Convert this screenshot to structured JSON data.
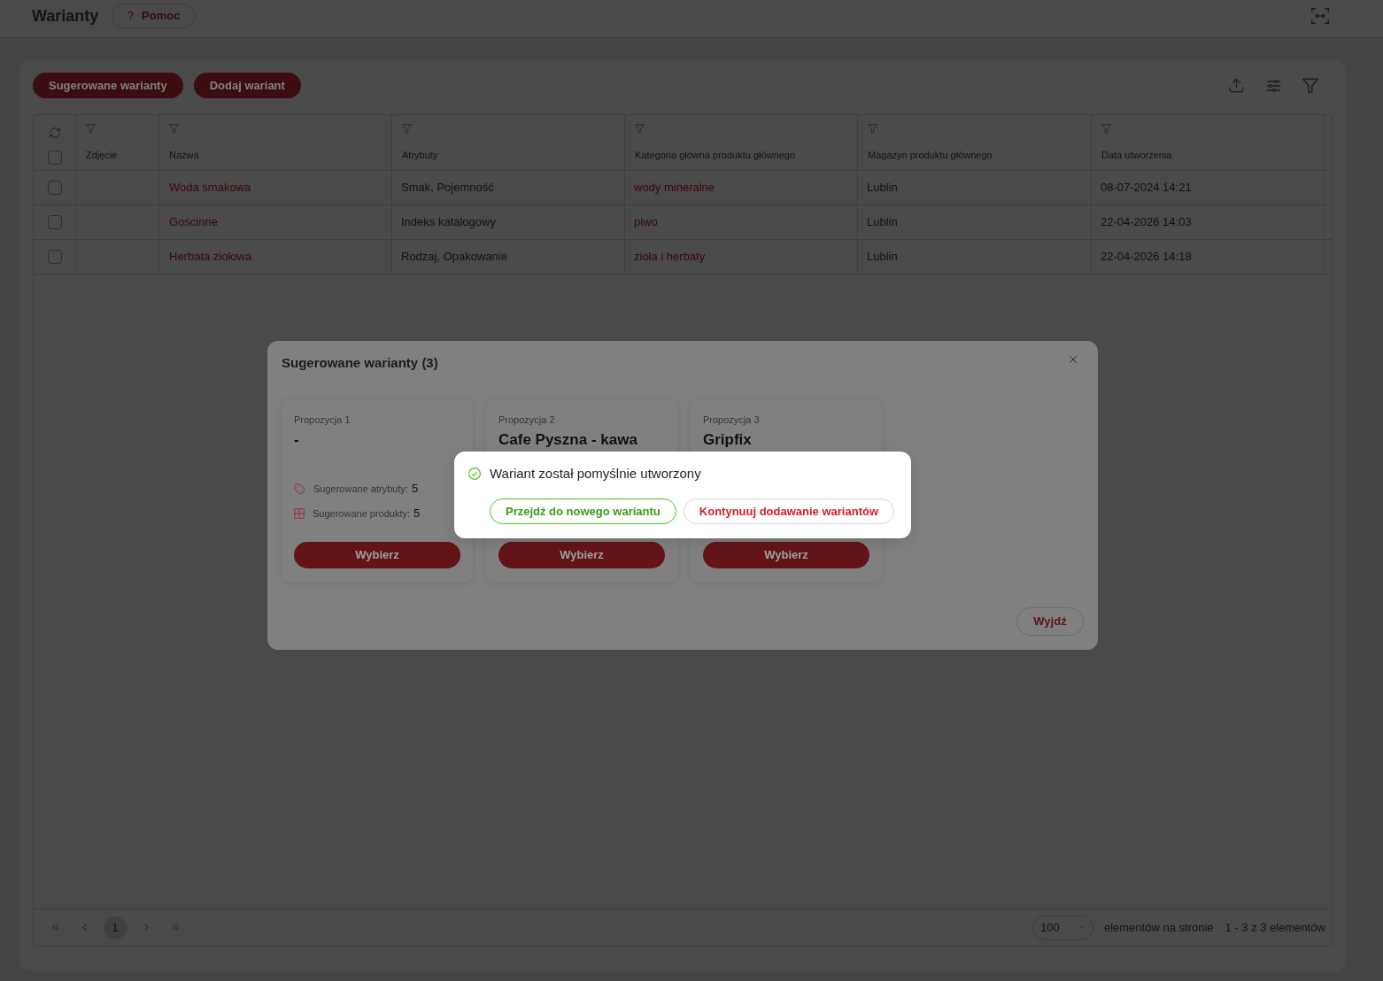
{
  "header": {
    "title": "Warianty",
    "help_button": {
      "icon": "?",
      "label": "Pomoc"
    }
  },
  "toolbar": {
    "buttons": [
      "Sugerowane warianty",
      "Dodaj wariant"
    ]
  },
  "table": {
    "select_all_checked": false,
    "columns": [
      {
        "label": "Zdjęcie",
        "filter": true
      },
      {
        "label": "Nazwa",
        "filter": true
      },
      {
        "label": "Atrybuty",
        "filter": true
      },
      {
        "label": "Kategoria główna produktu głównego",
        "filter": true
      },
      {
        "label": "Magazyn produktu głównego",
        "filter": true
      },
      {
        "label": "Data utworzenia",
        "filter": true
      }
    ],
    "rows": [
      {
        "checked": false,
        "name": "Woda smakowa",
        "attributes": "Smak, Pojemność",
        "category": "wody mineralne",
        "warehouse": "Lublin",
        "created": "08-07-2024 14:21"
      },
      {
        "checked": false,
        "name": "Gościnne",
        "attributes": "Indeks katalogowy",
        "category": "piwo",
        "warehouse": "Lublin",
        "created": "22-04-2026 14:03"
      },
      {
        "checked": false,
        "name": "Herbata ziołowa",
        "attributes": "Rodzaj, Opakowanie",
        "category": "zioła i herbaty",
        "warehouse": "Lublin",
        "created": "22-04-2026 14:18"
      }
    ]
  },
  "pagination": {
    "nav_disabled": true,
    "pages": [
      {
        "label": "1",
        "selected": true
      }
    ],
    "page_size": "100",
    "page_size_label": "elementów na stronie",
    "range": "1 - 3 z 3 elementów"
  },
  "modal": {
    "title": "Sugerowane warianty (3)",
    "cards": [
      {
        "label": "Propozycja 1",
        "title": "-",
        "stats": [
          {
            "kind": "attributes",
            "label": "Sugerowane atrybuty:",
            "value": "5"
          },
          {
            "kind": "products",
            "label": "Sugerowane produkty:",
            "value": "5"
          }
        ],
        "button": "Wybierz"
      },
      {
        "label": "Propozycja 2",
        "title": "Cafe Pyszna - kawa",
        "button": "Wybierz"
      },
      {
        "label": "Propozycja 3",
        "title": "Gripfix",
        "button": "Wybierz"
      }
    ],
    "exit_button": "Wyjdź"
  },
  "toast": {
    "kind": "success",
    "title": "Wariant został pomyślnie utworzony",
    "buttons": [
      {
        "kind": "success",
        "label": "Przejdź do nowego wariantu"
      },
      {
        "kind": "danger",
        "label": "Kontynuuj dodawanie wariantów"
      }
    ]
  }
}
